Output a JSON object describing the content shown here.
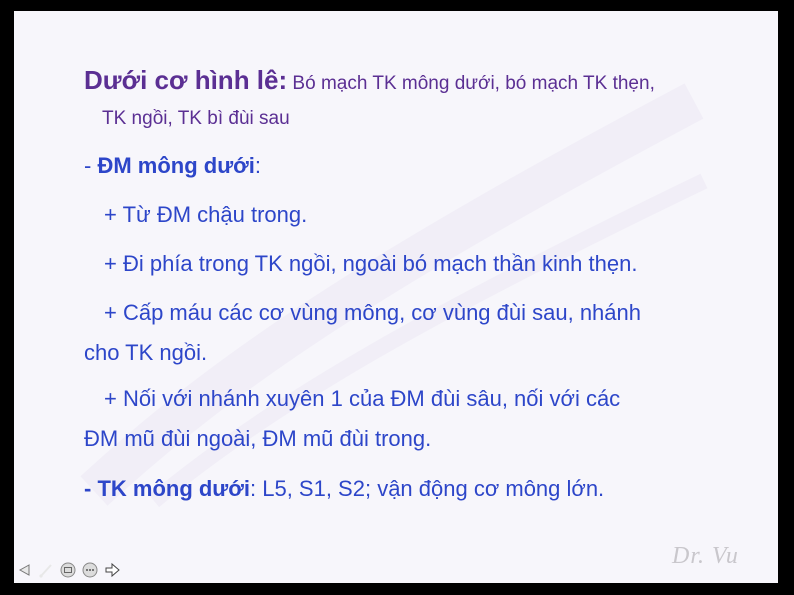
{
  "slide": {
    "heading": {
      "title": "Dưới cơ hình lê:",
      "title_rest": " Bó mạch TK mông dưới, bó mạch TK thẹn,",
      "title_line2": "TK ngồi, TK bì đùi sau"
    },
    "artery_section": {
      "dash": "- ",
      "label": "ĐM mông dưới",
      "colon": ":",
      "bullets": [
        "+ Từ ĐM chậu trong.",
        "+ Đi phía trong TK ngồi, ngoài bó mạch thần kinh thẹn.",
        "+ Cấp máu các cơ vùng mông, cơ vùng đùi sau, nhánh",
        "cho TK ngồi.",
        "+ Nối với nhánh xuyên 1 của ĐM đùi sâu, nối với các",
        "ĐM mũ đùi ngoài, ĐM mũ đùi trong."
      ]
    },
    "nerve_section": {
      "label": "- TK mông dưới",
      "rest": ": L5, S1, S2; vận động cơ mông lớn."
    },
    "signature": "Dr. Vu"
  },
  "controls": [
    {
      "icon": "previous-icon"
    },
    {
      "icon": "pen-icon"
    },
    {
      "icon": "slide-menu-icon"
    },
    {
      "icon": "more-options-icon"
    },
    {
      "icon": "next-icon"
    }
  ],
  "colors": {
    "title": "#5b2f93",
    "body": "#2d46c9",
    "background": "#f7f6fb",
    "frame": "#000000"
  }
}
